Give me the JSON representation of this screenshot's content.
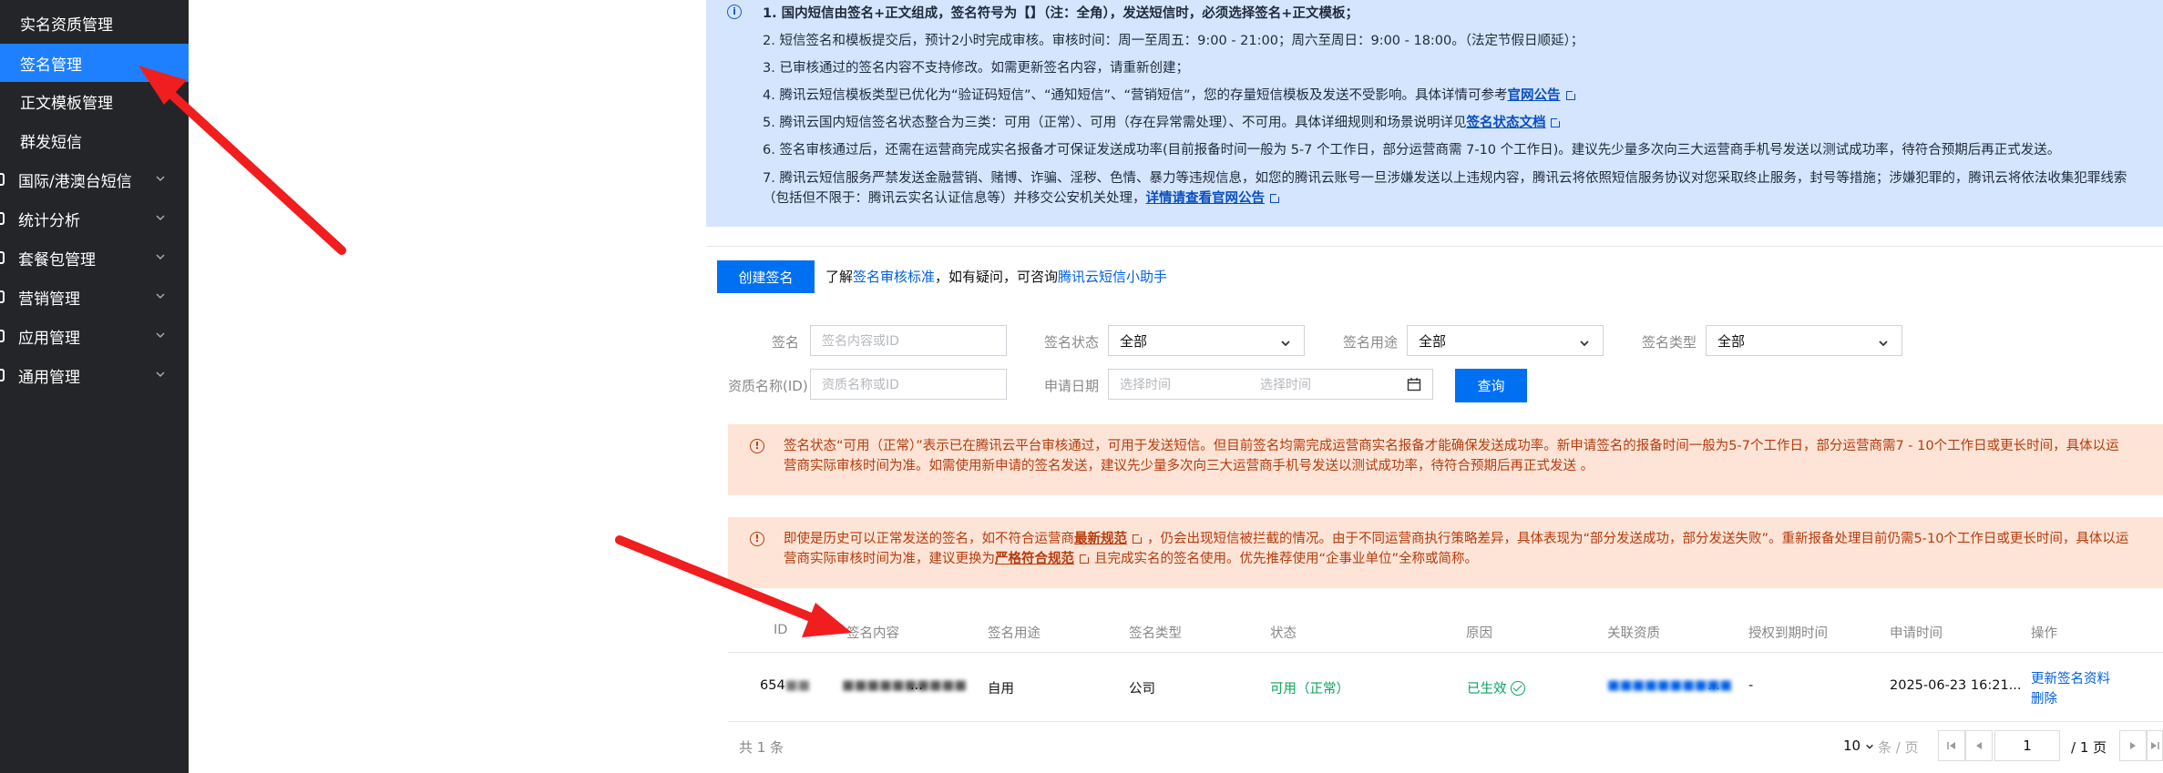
{
  "sidebar": {
    "items": [
      {
        "label": "实名资质管理",
        "active": false,
        "group": false
      },
      {
        "label": "签名管理",
        "active": true,
        "group": false
      },
      {
        "label": "正文模板管理",
        "active": false,
        "group": false
      },
      {
        "label": "群发短信",
        "active": false,
        "group": false
      },
      {
        "label": "国际/港澳台短信",
        "active": false,
        "group": true
      },
      {
        "label": "统计分析",
        "active": false,
        "group": true
      },
      {
        "label": "套餐包管理",
        "active": false,
        "group": true
      },
      {
        "label": "营销管理",
        "active": false,
        "group": true
      },
      {
        "label": "应用管理",
        "active": false,
        "group": true
      },
      {
        "label": "通用管理",
        "active": false,
        "group": true
      }
    ]
  },
  "notice": {
    "line1": "1. 国内短信由签名+正文组成，签名符号为【】（注：全角），发送短信时，必须选择签名+正文模板；",
    "line2": "2. 短信签名和模板提交后，预计2小时完成审核。审核时间：周一至周五：9:00 - 21:00；周六至周日：9:00 - 18:00。（法定节假日顺延）；",
    "line3": "3. 已审核通过的签名内容不支持修改。如需更新签名内容，请重新创建；",
    "line4_text": "4. 腾讯云短信模板类型已优化为“验证码短信”、“通知短信”、“营销短信”，您的存量短信模板及发送不受影响。具体详情可参考",
    "line4_link": "官网公告",
    "line5_text": "5. 腾讯云国内短信签名状态整合为三类：可用（正常）、可用（存在异常需处理）、不可用。具体详细规则和场景说明详见",
    "line5_link": "签名状态文档",
    "line6": "6. 签名审核通过后，还需在运营商完成实名报备才可保证发送成功率(目前报备时间一般为 5-7 个工作日，部分运营商需 7-10 个工作日)。建议先少量多次向三大运营商手机号发送以测试成功率，待符合预期后再正式发送。",
    "line7_text": "7. 腾讯云短信服务严禁发送金融营销、赌博、诈骗、淫秽、色情、暴力等违规信息，如您的腾讯云账号一旦涉嫌发送以上违规内容，腾讯云将依照短信服务协议对您采取终止服务，封号等措施；涉嫌犯罪的，腾讯云将依法收集犯罪线索（包括但不限于：腾讯云实名认证信息等）并移交公安机关处理，",
    "line7_link": "详情请查看官网公告"
  },
  "toolbar": {
    "create_label": "创建签名",
    "tip_prefix": "了解",
    "tip_link1": "签名审核标准",
    "tip_mid": "，如有疑问，可咨询",
    "tip_link2": "腾讯云短信小助手"
  },
  "filters": {
    "sign_label": "签名",
    "sign_placeholder": "签名内容或ID",
    "status_label": "签名状态",
    "status_value": "全部",
    "usage_label": "签名用途",
    "usage_value": "全部",
    "type_label": "签名类型",
    "type_value": "全部",
    "qual_label": "资质名称(ID)",
    "qual_placeholder": "资质名称或ID",
    "date_label": "申请日期",
    "date_start_placeholder": "选择时间",
    "date_end_placeholder": "选择时间",
    "query_label": "查询"
  },
  "warnings": {
    "w1": "签名状态“可用（正常）”表示已在腾讯云平台审核通过，可用于发送短信。但目前签名均需完成运营商实名报备才能确保发送成功率。新申请签名的报备时间一般为5-7个工作日，部分运营商需7 - 10个工作日或更长时间，具体以运营商实际审核时间为准。如需使用新申请的签名发送，建议先少量多次向三大运营商手机号发送以测试成功率，待符合预期后再正式发送 。",
    "w2_a": "即使是历史可以正常发送的签名，如不符合运营商",
    "w2_link1": "最新规范",
    "w2_b": "，仍会出现短信被拦截的情况。由于不同运营商执行策略差异，具体表现为“部分发送成功，部分发送失败”。重新报备处理目前仍需5-10个工作日或更长时间，具体以运营商实际审核时间为准，建议更换为",
    "w2_link2": "严格符合规范",
    "w2_c": "且完成实名的签名使用。优先推荐使用“企事业单位”全称或简称。"
  },
  "table": {
    "headers": [
      "ID",
      "签名内容",
      "签名用途",
      "签名类型",
      "状态",
      "原因",
      "关联资质",
      "授权到期时间",
      "申请时间",
      "操作"
    ],
    "row": {
      "id": "654",
      "content": "...",
      "usage": "自用",
      "type": "公司",
      "status": "可用（正常）",
      "reason": "已生效",
      "qualification": "...",
      "expire": "-",
      "apply_time": "2025-06-23 16:21...",
      "action1": "更新签名资料",
      "action2": "删除"
    }
  },
  "pagination": {
    "total": "共 1 条",
    "page_size": "10",
    "page_unit": "条 / 页",
    "current_page": "1",
    "total_pages": "/ 1 页"
  },
  "colors": {
    "sidebar_bg": "#232528",
    "active": "#1e80ff",
    "primary": "#0070f3",
    "notice_bg": "#d4e5fd",
    "warn_bg": "#fde4d6",
    "warn_text": "#b63b0e",
    "success": "#0aa35a",
    "arrow": "#f01e1e"
  }
}
